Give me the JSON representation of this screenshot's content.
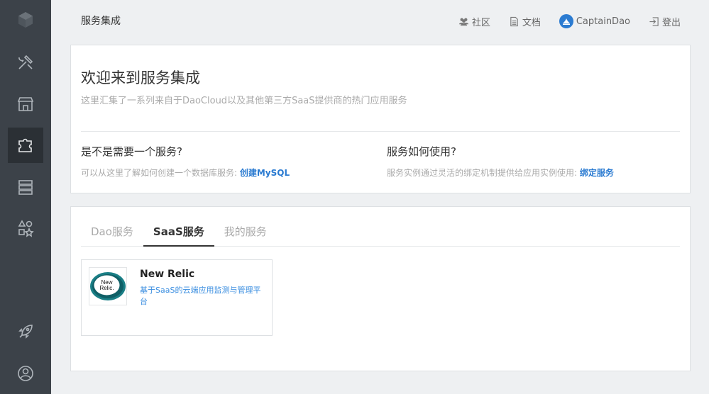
{
  "header": {
    "title": "服务集成",
    "nav": {
      "community": "社区",
      "docs": "文档",
      "user": "CaptainDao",
      "logout": "登出"
    }
  },
  "welcome": {
    "title": "欢迎来到服务集成",
    "subtitle": "这里汇集了一系列来自于DaoCloud以及其他第三方SaaS提供商的热门应用服务",
    "left": {
      "heading": "是不是需要一个服务?",
      "text": "可以从这里了解如何创建一个数据库服务: ",
      "link": "创建MySQL"
    },
    "right": {
      "heading": "服务如何使用?",
      "text": "服务实例通过灵活的绑定机制提供给应用实例使用: ",
      "link": "绑定服务"
    }
  },
  "services": {
    "tabs": [
      "Dao服务",
      "SaaS服务",
      "我的服务"
    ],
    "active_tab": "SaaS服务",
    "items": [
      {
        "name": "New Relic",
        "description": "基于SaaS的云端应用监测与管理平台",
        "logo_text_1": "New",
        "logo_text_2": "Relic."
      }
    ]
  },
  "colors": {
    "sidebar_bg": "#3c4249",
    "accent_link": "#2b7bd1",
    "newrelic_teal": "#1a7f86"
  },
  "icons": {
    "sidebar": [
      "cube-logo-icon",
      "tools-icon",
      "store-icon",
      "puzzle-icon",
      "server-icon",
      "shapes-icon",
      "rocket-icon",
      "user-circle-icon"
    ],
    "nav": [
      "users-icon",
      "document-icon",
      "avatar-icon",
      "logout-icon"
    ]
  }
}
